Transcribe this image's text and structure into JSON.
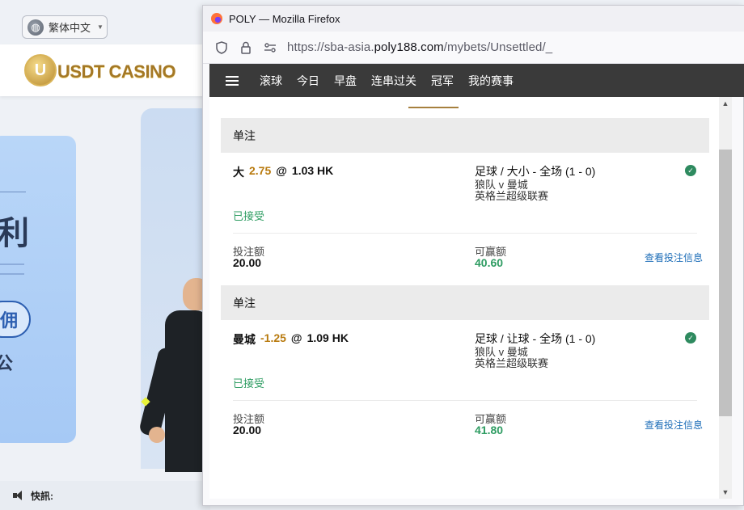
{
  "background_site": {
    "language_label": "繁体中文",
    "logo_text": "USDT CASINO",
    "logo_coin_letter": "U",
    "promo_big_text": "利",
    "promo_button_text": "佣",
    "promo_small_text": "公",
    "ticker_label": "快訊:"
  },
  "browser": {
    "window_title": "POLY — Mozilla Firefox",
    "url_prefix": "https://sba-asia.",
    "url_domain": "poly188.com",
    "url_path": "/mybets/Unsettled/_"
  },
  "nav": {
    "items": [
      "滚球",
      "今日",
      "早盘",
      "连串过关",
      "冠军",
      "我的赛事"
    ]
  },
  "bets": [
    {
      "header": "单注",
      "selection": "大",
      "handicap": "2.75",
      "at": "@",
      "odds": "1.03 HK",
      "market": "足球 / 大小 - 全场 (1 - 0)",
      "teams": "狼队 v 曼城",
      "league": "英格兰超级联赛",
      "status": "已接受",
      "stake_label": "投注额",
      "stake_value": "20.00",
      "win_label": "可赢额",
      "win_value": "40.60",
      "view_link": "查看投注信息"
    },
    {
      "header": "单注",
      "selection": "曼城",
      "handicap": "-1.25",
      "at": "@",
      "odds": "1.09 HK",
      "market": "足球 / 让球 - 全场 (1 - 0)",
      "teams": "狼队 v 曼城",
      "league": "英格兰超级联赛",
      "status": "已接受",
      "stake_label": "投注额",
      "stake_value": "20.00",
      "win_label": "可赢额",
      "win_value": "41.80",
      "view_link": "查看投注信息"
    }
  ],
  "colors": {
    "accent_gold": "#a6803e",
    "handicap_orange": "#b87a0e",
    "success_green": "#2e9c62",
    "link_blue": "#1e6eb8",
    "nav_bg": "#3a3a3a"
  }
}
